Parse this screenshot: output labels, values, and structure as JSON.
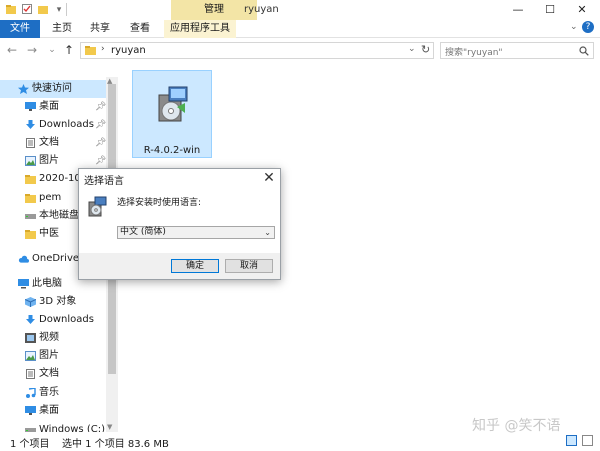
{
  "window": {
    "title": "ryuyan",
    "context_tab": "管理",
    "minimize": "—",
    "maximize": "☐",
    "close": "✕"
  },
  "ribbon": {
    "tabs": [
      "文件",
      "主页",
      "共享",
      "查看",
      "应用程序工具"
    ]
  },
  "address": {
    "path_folder": "ryuyan",
    "search_placeholder": "搜索\"ryuyan\""
  },
  "sidebar": {
    "quick_access": "快速访问",
    "items": [
      {
        "label": "桌面",
        "icon": "desktop-icon",
        "pinned": true
      },
      {
        "label": "Downloads",
        "icon": "download-icon",
        "pinned": true
      },
      {
        "label": "文档",
        "icon": "document-icon",
        "pinned": true
      },
      {
        "label": "图片",
        "icon": "picture-icon",
        "pinned": true
      },
      {
        "label": "2020-10",
        "icon": "folder-icon",
        "pinned": false
      },
      {
        "label": "pem",
        "icon": "folder-icon",
        "pinned": false
      },
      {
        "label": "本地磁盘",
        "icon": "drive-icon",
        "pinned": false
      },
      {
        "label": "中医",
        "icon": "folder-icon",
        "pinned": false
      }
    ],
    "onedrive": "OneDrive",
    "this_pc": "此电脑",
    "pc_items": [
      {
        "label": "3D 对象",
        "icon": "cube-icon"
      },
      {
        "label": "Downloads",
        "icon": "download-icon"
      },
      {
        "label": "视频",
        "icon": "video-icon"
      },
      {
        "label": "图片",
        "icon": "picture-icon"
      },
      {
        "label": "文档",
        "icon": "document-icon"
      },
      {
        "label": "音乐",
        "icon": "music-icon"
      },
      {
        "label": "桌面",
        "icon": "desktop-icon"
      },
      {
        "label": "Windows (C:)",
        "icon": "drive-icon"
      }
    ]
  },
  "content": {
    "file_name": "R-4.0.2-win"
  },
  "dialog": {
    "title": "选择语言",
    "prompt": "选择安装时使用语言:",
    "selected_language": "中文 (简体)",
    "ok_label": "确定",
    "cancel_label": "取消"
  },
  "status": {
    "item_count": "1 个项目",
    "selection": "选中 1 个项目 83.6 MB"
  },
  "watermark": "知乎 @笑不语",
  "colors": {
    "accent": "#1e6ec4",
    "context_tab": "#f3e5a6",
    "selection": "#cce8ff"
  }
}
